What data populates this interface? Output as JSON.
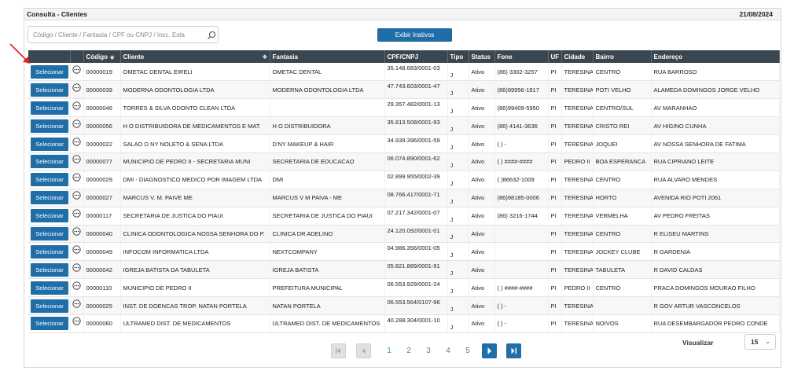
{
  "header": {
    "title": "Consulta - Clientes",
    "date": "21/08/2024"
  },
  "search": {
    "placeholder": "Código / Cliente / Fantasia / CPF ou CNPJ / Insc. Esta"
  },
  "toolbar": {
    "inativos_label": "Exibir Inativos"
  },
  "table": {
    "columns": {
      "codigo": "Código",
      "cliente": "Cliente",
      "fantasia": "Fantasia",
      "cnpj": "CPF/CNPJ",
      "tipo": "Tipo",
      "status": "Status",
      "fone": "Fone",
      "uf": "UF",
      "cidade": "Cidade",
      "bairro": "Bairro",
      "endereco": "Endereço"
    },
    "select_label": "Selecionar",
    "rows": [
      {
        "codigo": "00000019",
        "cliente": "OMETAC DENTAL EIRELI",
        "fantasia": "OMETAC DENTAL",
        "cnpj": "35.148.683/0001-03",
        "tipo": "J",
        "status": "Ativo",
        "fone": "(86) 3302-3257",
        "uf": "PI",
        "cidade": "TERESINA",
        "bairro": "CENTRO",
        "endereco": "RUA BARROSO"
      },
      {
        "codigo": "00000039",
        "cliente": "MODERNA ODONTOLOGIA LTDA",
        "fantasia": "MODERNA ODONTOLOGIA LTDA",
        "cnpj": "47.743.603/0001-47",
        "tipo": "J",
        "status": "Ativo",
        "fone": "(86)99956-1917",
        "uf": "PI",
        "cidade": "TERESINA",
        "bairro": "POTI VELHO",
        "endereco": "ALAMEDA DOMINGOS JORGE VELHO"
      },
      {
        "codigo": "00000046",
        "cliente": "TORRES & SILVA ODONTO CLEAN LTDA",
        "fantasia": "",
        "cnpj": "29.357.482/0001-13",
        "tipo": "J",
        "status": "Ativo",
        "fone": "(86)99409-5950",
        "uf": "PI",
        "cidade": "TERESINA",
        "bairro": "CENTRO/SUL",
        "endereco": "AV MARANHAO"
      },
      {
        "codigo": "00000056",
        "cliente": "H O DISTRIBUIDORA DE MEDICAMENTOS E MAT.",
        "fantasia": "H O DISTRIBUIDORA",
        "cnpj": "35.813.508/0001-93",
        "tipo": "J",
        "status": "Ativo",
        "fone": "(86) 4141-3636",
        "uf": "PI",
        "cidade": "TERESINA",
        "bairro": "CRISTO REI",
        "endereco": "AV HIGINO CUNHA"
      },
      {
        "codigo": "00000022",
        "cliente": "SALAO D NY NOLETO & SENA LTDA",
        "fantasia": "D'NY MAKEUP & HAIR",
        "cnpj": "34.939.396/0001-59",
        "tipo": "J",
        "status": "Ativo",
        "fone": "( ) -",
        "uf": "PI",
        "cidade": "TERESINA",
        "bairro": "JOQUEI",
        "endereco": "AV NOSSA SENHORA DE FATIMA"
      },
      {
        "codigo": "00000077",
        "cliente": "MUNICIPIO DE PEDRO II - SECRETARIA MUNI",
        "fantasia": "SECRETARIA DE EDUCACAO",
        "cnpj": "06.074.890/0001-62",
        "tipo": "J",
        "status": "Ativo",
        "fone": "( ) ####-####",
        "uf": "PI",
        "cidade": "PEDRO II",
        "bairro": "BOA ESPERANCA",
        "endereco": "RUA CIPRIANO LEITE"
      },
      {
        "codigo": "00000029",
        "cliente": "DMI - DIAGNOSTICO MEDICO POR IMAGEM LTDA",
        "fantasia": "DMI",
        "cnpj": "02.899.955/0002-39",
        "tipo": "J",
        "status": "Ativo",
        "fone": "( )86632-1009",
        "uf": "PI",
        "cidade": "TERESINA",
        "bairro": "CENTRO",
        "endereco": "RUA ALVARO MENDES"
      },
      {
        "codigo": "00000027",
        "cliente": "MARCUS V. M. PAIVE ME",
        "fantasia": "MARCUS V M PAIVA - ME",
        "cnpj": "08.766.417/0001-71",
        "tipo": "J",
        "status": "Ativo",
        "fone": "(86)98185-0006",
        "uf": "PI",
        "cidade": "TERESINA",
        "bairro": "HORTO",
        "endereco": "AVENIDA RIO POTI 2061"
      },
      {
        "codigo": "00000117",
        "cliente": "SECRETARIA DE JUSTICA DO PIAUI",
        "fantasia": "SECRETARIA DE JUSTICA DO PIAUI",
        "cnpj": "07.217.342/0001-07",
        "tipo": "J",
        "status": "Ativo",
        "fone": "(86) 3216-1744",
        "uf": "PI",
        "cidade": "TERESINA",
        "bairro": "VERMELHA",
        "endereco": "AV PEDRO FREITAS"
      },
      {
        "codigo": "00000040",
        "cliente": "CLINICA ODONTOLOGICA NOSSA SENHORA DO P.",
        "fantasia": "CLINICA DR ADELINO",
        "cnpj": "24.120.092/0001-01",
        "tipo": "J",
        "status": "Ativo",
        "fone": "",
        "uf": "PI",
        "cidade": "TERESINA",
        "bairro": "CENTRO",
        "endereco": "R ELISEU MARTINS"
      },
      {
        "codigo": "00000049",
        "cliente": "INFOCOM INFORMATICA LTDA",
        "fantasia": "NEXTCOMPANY",
        "cnpj": "04.986.356/0001-05",
        "tipo": "J",
        "status": "Ativo",
        "fone": "",
        "uf": "PI",
        "cidade": "TERESINA",
        "bairro": "JOCKEY CLUBE",
        "endereco": "R GARDENIA"
      },
      {
        "codigo": "00000042",
        "cliente": "IGREJA BATISTA DA TABULETA",
        "fantasia": "IGREJA BATISTA",
        "cnpj": "05.821.889/0001-91",
        "tipo": "J",
        "status": "Ativo",
        "fone": "",
        "uf": "PI",
        "cidade": "TERESINA",
        "bairro": "TABULETA",
        "endereco": "R DAVID CALDAS"
      },
      {
        "codigo": "00000110",
        "cliente": "MUNICIPIO DE PEDRO II",
        "fantasia": "PREFEITURA MUNICIPAL",
        "cnpj": "06.553.929/0001-24",
        "tipo": "J",
        "status": "Ativo",
        "fone": "( ) ####-####",
        "uf": "PI",
        "cidade": "PEDRO II",
        "bairro": "CENTRO",
        "endereco": "PRACA DOMINGOS MOURAO FILHO"
      },
      {
        "codigo": "00000025",
        "cliente": "INST. DE DOENCAS TROP. NATAN PORTELA",
        "fantasia": "NATAN PORTELA",
        "cnpj": "06.553.564/0107-96",
        "tipo": "J",
        "status": "Ativo",
        "fone": "( ) -",
        "uf": "PI",
        "cidade": "TERESINA",
        "bairro": "",
        "endereco": "R GOV ARTUR VASCONCELOS"
      },
      {
        "codigo": "00000060",
        "cliente": "ULTRAMED DIST. DE MEDICAMENTOS",
        "fantasia": "ULTRAMED DIST. DE MEDICAMENTOS",
        "cnpj": "40.288.304/0001-10",
        "tipo": "J",
        "status": "Ativo",
        "fone": "( ) -",
        "uf": "PI",
        "cidade": "TERESINA",
        "bairro": "NOIVOS",
        "endereco": "RUA DESEMBARGADOR PEDRO CONDE"
      }
    ]
  },
  "pagination": {
    "pages": [
      "1",
      "2",
      "3",
      "4",
      "5"
    ],
    "current": "1"
  },
  "footer": {
    "visualizar_label": "Visualizar",
    "page_size": "15"
  },
  "colors": {
    "accent": "#1f6ea8",
    "header_bg": "#3b4750",
    "annotation_arrow": "#e0201b"
  }
}
